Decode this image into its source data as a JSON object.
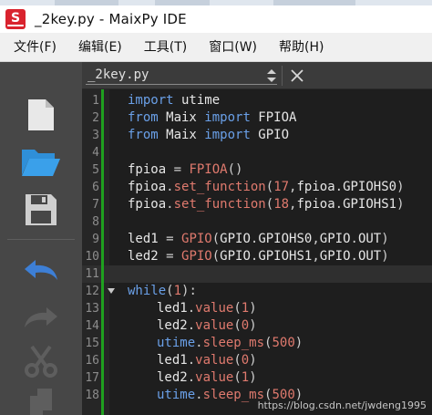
{
  "window": {
    "title": "_2key.py - MaixPy IDE",
    "logo_letter": "S",
    "logo_color": "#d9232e"
  },
  "menu": [
    {
      "label": "文件(F)"
    },
    {
      "label": "编辑(E)"
    },
    {
      "label": "工具(T)"
    },
    {
      "label": "窗口(W)"
    },
    {
      "label": "帮助(H)"
    }
  ],
  "toolbar": {
    "tools": [
      {
        "name": "new-file-icon",
        "enabled": true
      },
      {
        "name": "open-folder-icon",
        "enabled": true,
        "color": "#2f8fd8"
      },
      {
        "name": "save-icon",
        "enabled": true
      },
      {
        "name": "undo-icon",
        "enabled": true,
        "color": "#3d7fd6"
      },
      {
        "name": "redo-icon",
        "enabled": false
      },
      {
        "name": "cut-icon",
        "enabled": false
      },
      {
        "name": "copy-icon",
        "enabled": false
      }
    ]
  },
  "editor": {
    "tab_name": "_2key.py",
    "current_line": 11,
    "lines": [
      {
        "n": "1",
        "tokens": [
          [
            "kw",
            "import"
          ],
          [
            "txt",
            " utime"
          ]
        ]
      },
      {
        "n": "2",
        "tokens": [
          [
            "kw",
            "from"
          ],
          [
            "txt",
            " Maix "
          ],
          [
            "kw",
            "import"
          ],
          [
            "txt",
            " FPIOA"
          ]
        ]
      },
      {
        "n": "3",
        "tokens": [
          [
            "kw",
            "from"
          ],
          [
            "txt",
            " Maix "
          ],
          [
            "kw",
            "import"
          ],
          [
            "txt",
            " GPIO"
          ]
        ]
      },
      {
        "n": "4",
        "tokens": []
      },
      {
        "n": "5",
        "tokens": [
          [
            "txt",
            "fpioa "
          ],
          [
            "pu",
            "= "
          ],
          [
            "fn",
            "FPIOA"
          ],
          [
            "pu",
            "()"
          ]
        ]
      },
      {
        "n": "6",
        "tokens": [
          [
            "txt",
            "fpioa"
          ],
          [
            "pu",
            "."
          ],
          [
            "fn",
            "set_function"
          ],
          [
            "pu",
            "("
          ],
          [
            "num",
            "17"
          ],
          [
            "pu",
            ","
          ],
          [
            "txt",
            "fpioa"
          ],
          [
            "pu",
            "."
          ],
          [
            "txt",
            "GPIOHS0"
          ],
          [
            "pu",
            ")"
          ]
        ]
      },
      {
        "n": "7",
        "tokens": [
          [
            "txt",
            "fpioa"
          ],
          [
            "pu",
            "."
          ],
          [
            "fn",
            "set_function"
          ],
          [
            "pu",
            "("
          ],
          [
            "num",
            "18"
          ],
          [
            "pu",
            ","
          ],
          [
            "txt",
            "fpioa"
          ],
          [
            "pu",
            "."
          ],
          [
            "txt",
            "GPIOHS1"
          ],
          [
            "pu",
            ")"
          ]
        ]
      },
      {
        "n": "8",
        "tokens": []
      },
      {
        "n": "9",
        "tokens": [
          [
            "txt",
            "led1 "
          ],
          [
            "pu",
            "= "
          ],
          [
            "fn",
            "GPIO"
          ],
          [
            "pu",
            "("
          ],
          [
            "txt",
            "GPIO"
          ],
          [
            "pu",
            "."
          ],
          [
            "txt",
            "GPIOHS0"
          ],
          [
            "pu",
            ","
          ],
          [
            "txt",
            "GPIO"
          ],
          [
            "pu",
            "."
          ],
          [
            "txt",
            "OUT"
          ],
          [
            "pu",
            ")"
          ]
        ]
      },
      {
        "n": "10",
        "tokens": [
          [
            "txt",
            "led2 "
          ],
          [
            "pu",
            "= "
          ],
          [
            "fn",
            "GPIO"
          ],
          [
            "pu",
            "("
          ],
          [
            "txt",
            "GPIO"
          ],
          [
            "pu",
            "."
          ],
          [
            "txt",
            "GPIOHS1"
          ],
          [
            "pu",
            ","
          ],
          [
            "txt",
            "GPIO"
          ],
          [
            "pu",
            "."
          ],
          [
            "txt",
            "OUT"
          ],
          [
            "pu",
            ")"
          ]
        ]
      },
      {
        "n": "11",
        "tokens": []
      },
      {
        "n": "12",
        "fold": true,
        "tokens": [
          [
            "kw",
            "while"
          ],
          [
            "pu",
            "("
          ],
          [
            "num",
            "1"
          ],
          [
            "pu",
            "):"
          ]
        ]
      },
      {
        "n": "13",
        "indent": true,
        "tokens": [
          [
            "txt",
            "led1"
          ],
          [
            "pu",
            "."
          ],
          [
            "fn",
            "value"
          ],
          [
            "pu",
            "("
          ],
          [
            "num",
            "1"
          ],
          [
            "pu",
            ")"
          ]
        ]
      },
      {
        "n": "14",
        "indent": true,
        "tokens": [
          [
            "txt",
            "led2"
          ],
          [
            "pu",
            "."
          ],
          [
            "fn",
            "value"
          ],
          [
            "pu",
            "("
          ],
          [
            "num",
            "0"
          ],
          [
            "pu",
            ")"
          ]
        ]
      },
      {
        "n": "15",
        "indent": true,
        "tokens": [
          [
            "kw",
            "utime"
          ],
          [
            "pu",
            "."
          ],
          [
            "fn",
            "sleep_ms"
          ],
          [
            "pu",
            "("
          ],
          [
            "num",
            "500"
          ],
          [
            "pu",
            ")"
          ]
        ]
      },
      {
        "n": "16",
        "indent": true,
        "tokens": [
          [
            "txt",
            "led1"
          ],
          [
            "pu",
            "."
          ],
          [
            "fn",
            "value"
          ],
          [
            "pu",
            "("
          ],
          [
            "num",
            "0"
          ],
          [
            "pu",
            ")"
          ]
        ]
      },
      {
        "n": "17",
        "indent": true,
        "tokens": [
          [
            "txt",
            "led2"
          ],
          [
            "pu",
            "."
          ],
          [
            "fn",
            "value"
          ],
          [
            "pu",
            "("
          ],
          [
            "num",
            "1"
          ],
          [
            "pu",
            ")"
          ]
        ]
      },
      {
        "n": "18",
        "indent": true,
        "tokens": [
          [
            "kw",
            "utime"
          ],
          [
            "pu",
            "."
          ],
          [
            "fn",
            "sleep_ms"
          ],
          [
            "pu",
            "("
          ],
          [
            "num",
            "500"
          ],
          [
            "pu",
            ")"
          ]
        ]
      }
    ]
  },
  "watermark": "https://blog.csdn.net/jwdeng1995",
  "colors": {
    "keyword": "#6aa0e8",
    "function": "#e07a6e",
    "number": "#e07a6e",
    "modified_bar": "#1fa01f"
  }
}
